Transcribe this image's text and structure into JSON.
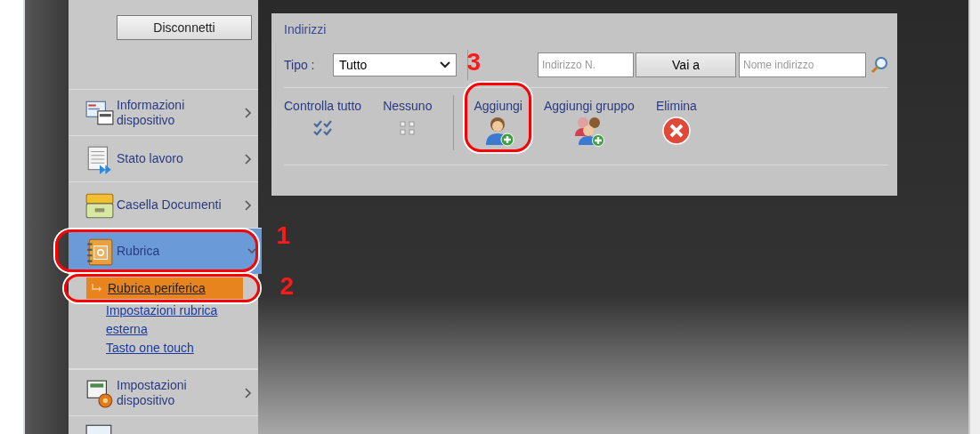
{
  "logout_button": "Disconnetti",
  "nav": [
    {
      "label": "Informazioni dispositivo",
      "kind": "info",
      "selected": false,
      "expanded": false
    },
    {
      "label": "Stato lavoro",
      "kind": "jobs",
      "selected": false,
      "expanded": false
    },
    {
      "label": "Casella Documenti",
      "kind": "box",
      "selected": false,
      "expanded": false
    },
    {
      "label": "Rubrica",
      "kind": "book",
      "selected": true,
      "expanded": true,
      "callout": "1",
      "children": [
        {
          "label": "Rubrica periferica",
          "selected": true,
          "callout": "2"
        },
        {
          "label": "Impostazioni rubrica esterna",
          "selected": false
        },
        {
          "label": "Tasto one touch",
          "selected": false
        }
      ]
    },
    {
      "label": "Impostazioni dispositivo",
      "kind": "settings",
      "selected": false,
      "expanded": false
    }
  ],
  "panel": {
    "title": "Indirizzi",
    "type_label": "Tipo :",
    "type_value": "Tutto",
    "number_field": {
      "placeholder": "Indirizzo N."
    },
    "goto_button": "Vai a",
    "name_field": {
      "placeholder": "Nome indirizzo"
    },
    "select_actions": [
      {
        "label": "Controlla tutto",
        "kind": "checkall"
      },
      {
        "label": "Nessuno",
        "kind": "none"
      }
    ],
    "actions": [
      {
        "label": "Aggiungi",
        "kind": "add",
        "callout": "3"
      },
      {
        "label": "Aggiungi gruppo",
        "kind": "addgroup"
      },
      {
        "label": "Elimina",
        "kind": "delete"
      }
    ]
  }
}
